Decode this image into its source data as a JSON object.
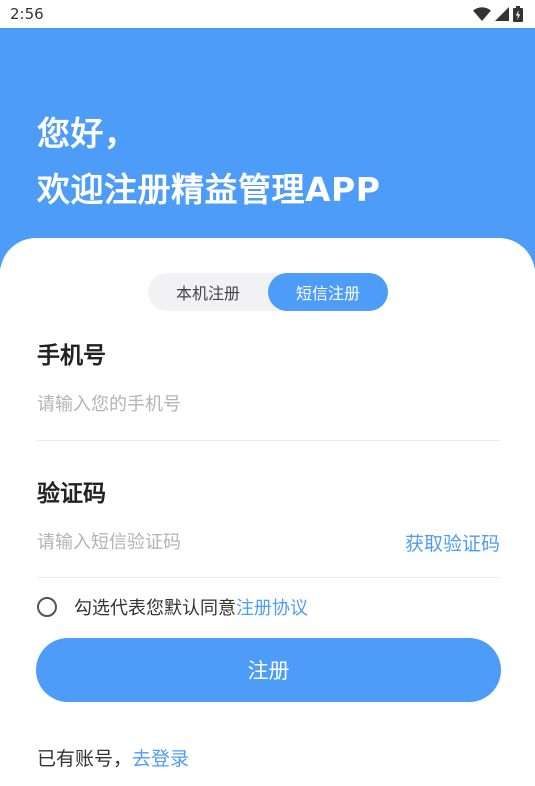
{
  "status_bar": {
    "time": "2:56"
  },
  "header": {
    "greeting": "您好，",
    "welcome": "欢迎注册精益管理APP"
  },
  "tabs": [
    {
      "label": "本机注册",
      "active": false
    },
    {
      "label": "短信注册",
      "active": true
    }
  ],
  "phone": {
    "label": "手机号",
    "placeholder": "请输入您的手机号",
    "value": ""
  },
  "code": {
    "label": "验证码",
    "placeholder": "请输入短信验证码",
    "value": "",
    "get_code_label": "获取验证码"
  },
  "agreement": {
    "text": "勾选代表您默认同意",
    "link": "注册协议",
    "checked": false
  },
  "submit_label": "注册",
  "login": {
    "text": "已有账号，",
    "link": "去登录"
  },
  "colors": {
    "accent": "#4d9cf8",
    "text": "#333333",
    "placeholder": "#b3b3b3"
  }
}
